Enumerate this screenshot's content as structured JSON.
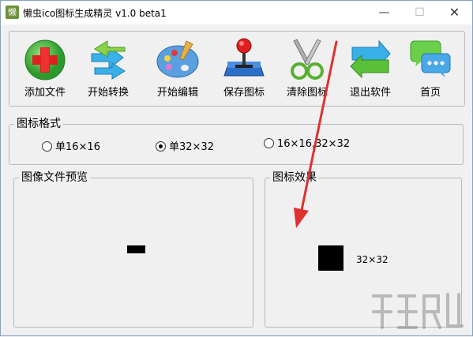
{
  "window": {
    "title": "懒虫ico图标生成精灵 v1.0 beta1",
    "app_icon_char": "懒",
    "controls": {
      "minimize": "—",
      "maximize": "☐",
      "close": "✕"
    }
  },
  "toolbar": {
    "buttons": [
      {
        "label": "添加文件",
        "icon": "add-file-icon"
      },
      {
        "label": "开始转换",
        "icon": "convert-arrows-icon"
      },
      {
        "label": "开始编辑",
        "icon": "palette-icon"
      },
      {
        "label": "保存图标",
        "icon": "joystick-icon"
      },
      {
        "label": "清除图标",
        "icon": "scissors-icon"
      },
      {
        "label": "退出软件",
        "icon": "exit-icon"
      },
      {
        "label": "首页",
        "icon": "chat-bubbles-icon"
      }
    ]
  },
  "format_group": {
    "title": "图标格式",
    "options": [
      {
        "label": "单16×16",
        "checked": false
      },
      {
        "label": "单32×32",
        "checked": true
      },
      {
        "label": "16×16,32×32",
        "checked": false
      }
    ]
  },
  "preview_group": {
    "title": "图像文件预览"
  },
  "effect_group": {
    "title": "图标效果",
    "size_label": "32×32"
  },
  "colors": {
    "accent_arrow": "#e03030",
    "title_bg": "#ffffff",
    "window_bg": "#f0f0f0"
  }
}
